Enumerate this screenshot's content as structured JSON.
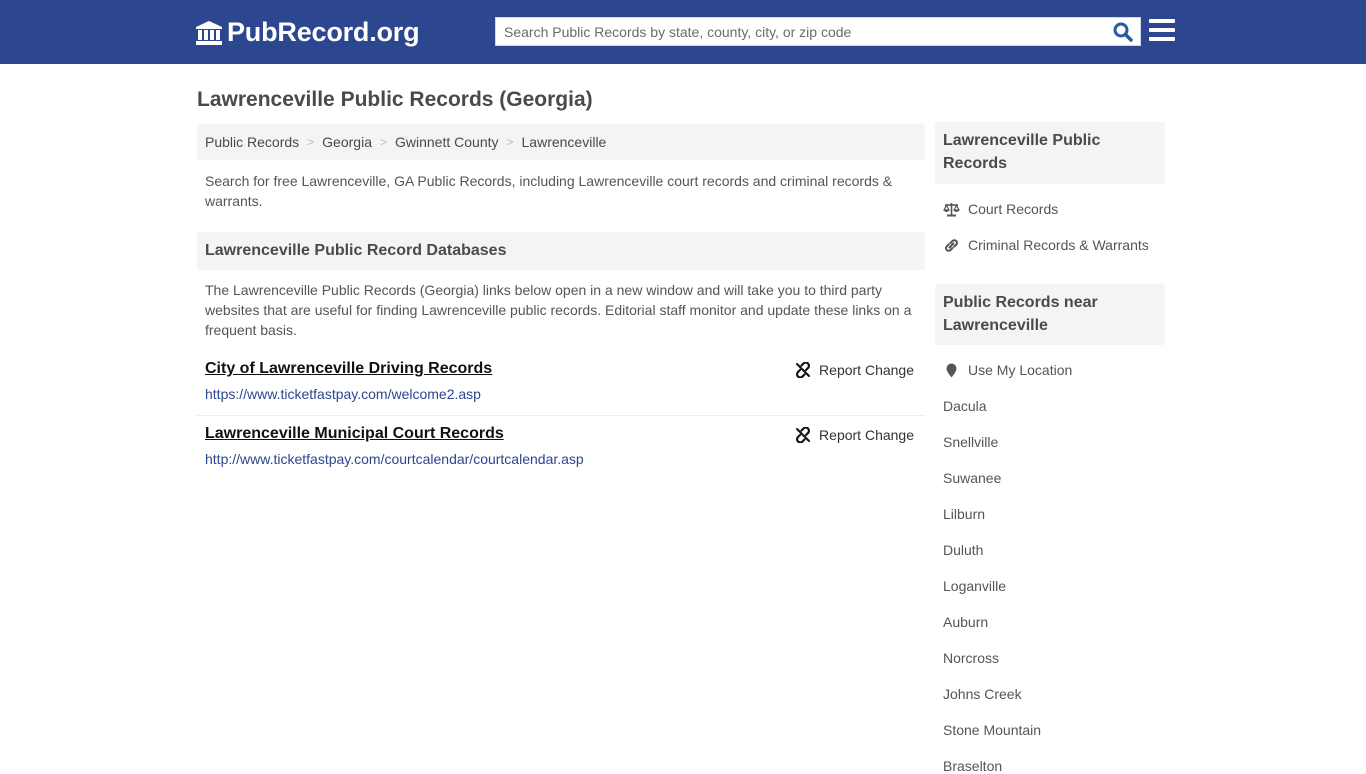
{
  "header": {
    "logo_text": "PubRecord.org",
    "search_placeholder": "Search Public Records by state, county, city, or zip code",
    "search_value": "",
    "colors": {
      "bar": "#2c4690",
      "accent": "#2c4690"
    }
  },
  "page": {
    "title": "Lawrenceville Public Records (Georgia)",
    "breadcrumb": [
      "Public Records",
      "Georgia",
      "Gwinnett County",
      "Lawrenceville"
    ],
    "breadcrumb_separator": ">",
    "intro": "Search for free Lawrenceville, GA Public Records, including Lawrenceville court records and criminal records & warrants."
  },
  "databases": {
    "heading": "Lawrenceville Public Record Databases",
    "description": "The Lawrenceville Public Records (Georgia) links below open in a new window and will take you to third party websites that are useful for finding Lawrenceville public records. Editorial staff monitor and update these links on a frequent basis.",
    "records": [
      {
        "title": "City of Lawrenceville Driving Records",
        "url": "https://www.ticketfastpay.com/welcome2.asp",
        "report_label": "Report Change"
      },
      {
        "title": "Lawrenceville Municipal Court Records",
        "url": "http://www.ticketfastpay.com/courtcalendar/courtcalendar.asp",
        "report_label": "Report Change"
      }
    ]
  },
  "sidebar": {
    "box1_title": "Lawrenceville Public Records",
    "box1_links": [
      {
        "label": "Court Records",
        "icon": "balance-scale-icon"
      },
      {
        "label": "Criminal Records & Warrants",
        "icon": "link-icon"
      }
    ],
    "box2_title": "Public Records near Lawrenceville",
    "use_location_label": "Use My Location",
    "nearby": [
      "Dacula",
      "Snellville",
      "Suwanee",
      "Lilburn",
      "Duluth",
      "Loganville",
      "Auburn",
      "Norcross",
      "Johns Creek",
      "Stone Mountain",
      "Braselton"
    ]
  }
}
